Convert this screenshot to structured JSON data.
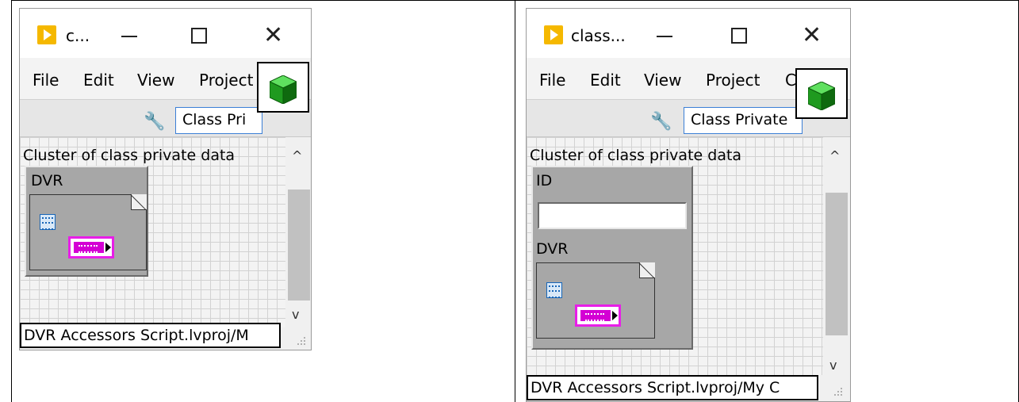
{
  "windows": [
    {
      "title": "c...",
      "menu": [
        "File",
        "Edit",
        "View",
        "Project"
      ],
      "toolbar": {
        "combo_value": "Class Pri"
      },
      "panel": {
        "label": "Cluster of class private data",
        "cluster_items": [
          {
            "label": "DVR",
            "kind": "dvr"
          }
        ]
      },
      "status": "DVR Accessors  Script.lvproj/M"
    },
    {
      "title": "class...",
      "menu": [
        "File",
        "Edit",
        "View",
        "Project",
        "C"
      ],
      "toolbar": {
        "combo_value": "Class Private"
      },
      "panel": {
        "label": "Cluster of class private data",
        "cluster_items": [
          {
            "label": "ID",
            "kind": "string",
            "value": ""
          },
          {
            "label": "DVR",
            "kind": "dvr"
          }
        ]
      },
      "status": "DVR Accessors  Script.lvproj/My C"
    }
  ],
  "colors": {
    "app_icon": "#f5b800",
    "dvr_terminal": "#e81ee8",
    "cluster_bg": "#a7a7a7",
    "combo_border": "#3b7fd6",
    "cube": "#22aa22"
  },
  "icons": [
    "labview-app-icon",
    "wrench-icon",
    "class-cube-icon",
    "data-value-reference-icon",
    "minimize-icon",
    "maximize-icon",
    "close-icon",
    "scroll-up-icon",
    "scroll-down-icon"
  ]
}
